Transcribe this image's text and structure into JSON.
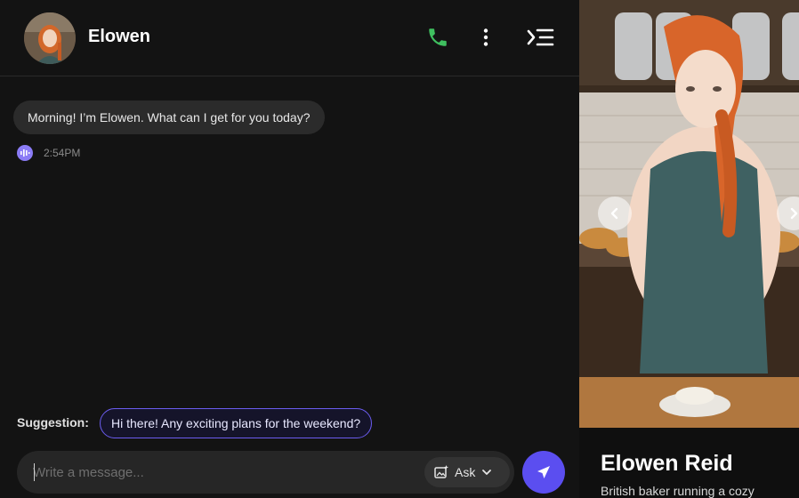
{
  "header": {
    "name": "Elowen",
    "icons": [
      "phone-icon",
      "more-vertical-icon",
      "collapse-panel-icon"
    ],
    "call_color": "#3fbf5f"
  },
  "messages": [
    {
      "text": "Morning! I’m Elowen. What can I get for you today?",
      "time": "2:54PM"
    }
  ],
  "suggestion": {
    "label": "Suggestion:",
    "text": "Hi there! Any exciting plans for the weekend?"
  },
  "composer": {
    "placeholder": "Write a message...",
    "ask_label": "Ask"
  },
  "profile": {
    "full_name": "Elowen Reid",
    "tagline": "British baker running a cozy"
  },
  "colors": {
    "accent": "#5b4ef0",
    "background": "#131313",
    "bubble": "#2b2b2b"
  }
}
